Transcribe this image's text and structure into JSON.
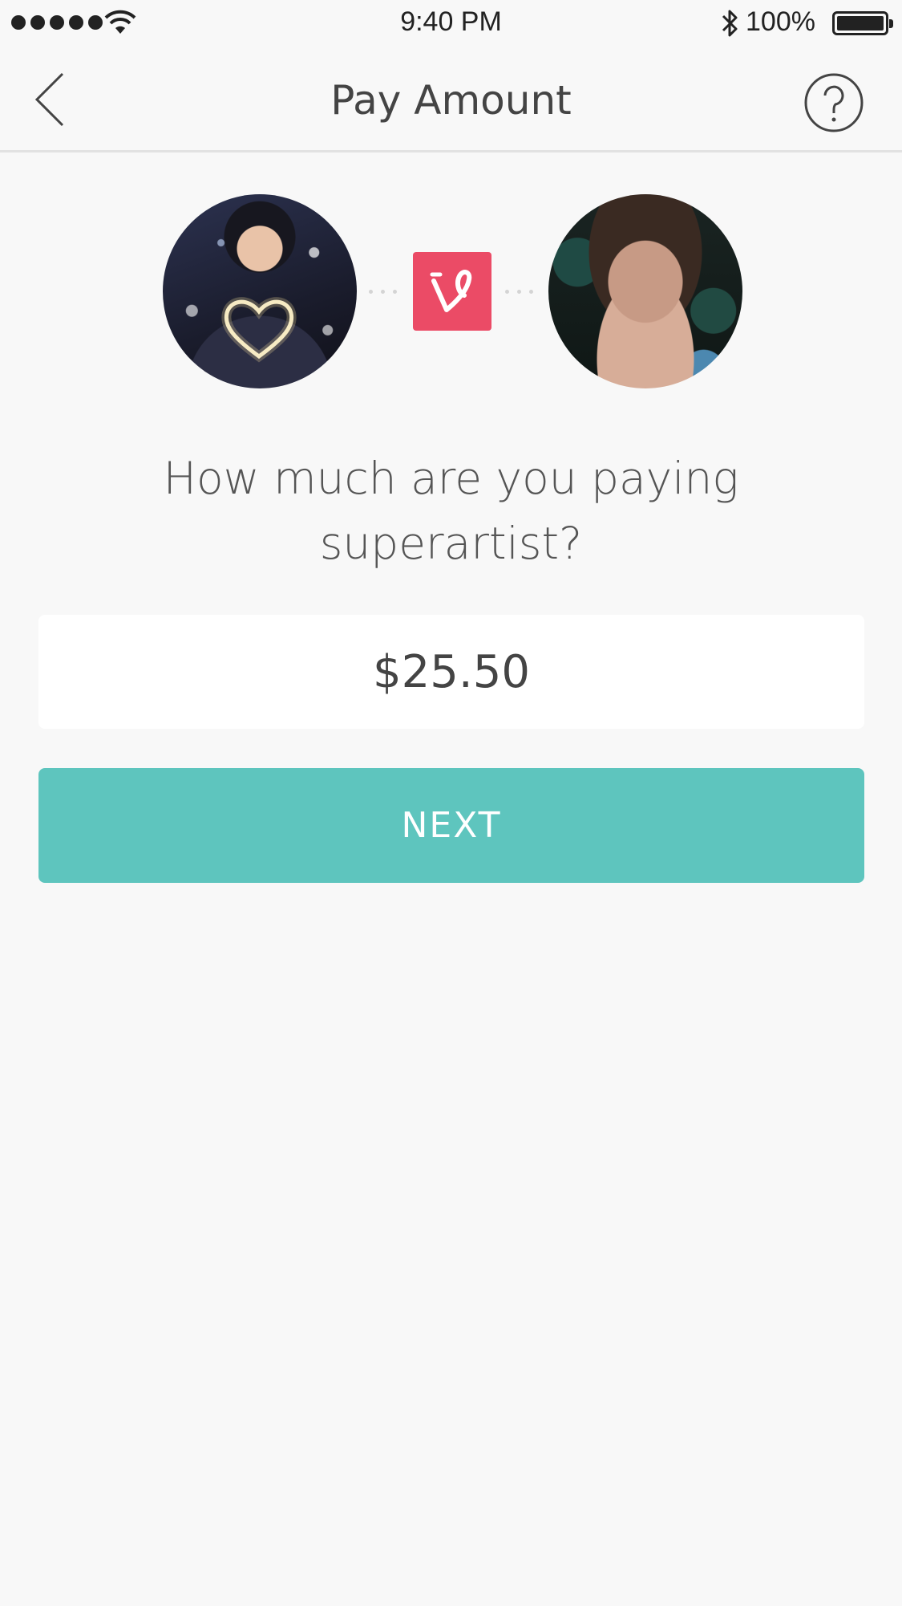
{
  "status_bar": {
    "time": "9:40 PM",
    "battery_percent": "100%",
    "signal_bars": 5,
    "icons": [
      "signal-dots-icon",
      "wifi-icon",
      "bluetooth-icon",
      "battery-icon"
    ]
  },
  "nav": {
    "title": "Pay Amount",
    "back_icon": "chevron-left-icon",
    "help_icon": "question-circle-icon"
  },
  "transfer": {
    "sender_avatar": "avatar-sender",
    "recipient_avatar": "avatar-recipient",
    "app_logo_icon": "vine-logo-icon"
  },
  "form": {
    "question": "How much are you paying superartist?",
    "amount_value": "$25.50",
    "next_label": "NEXT"
  },
  "colors": {
    "accent": "#5ec5be",
    "logo": "#eb4b66",
    "background": "#f8f8f8"
  }
}
